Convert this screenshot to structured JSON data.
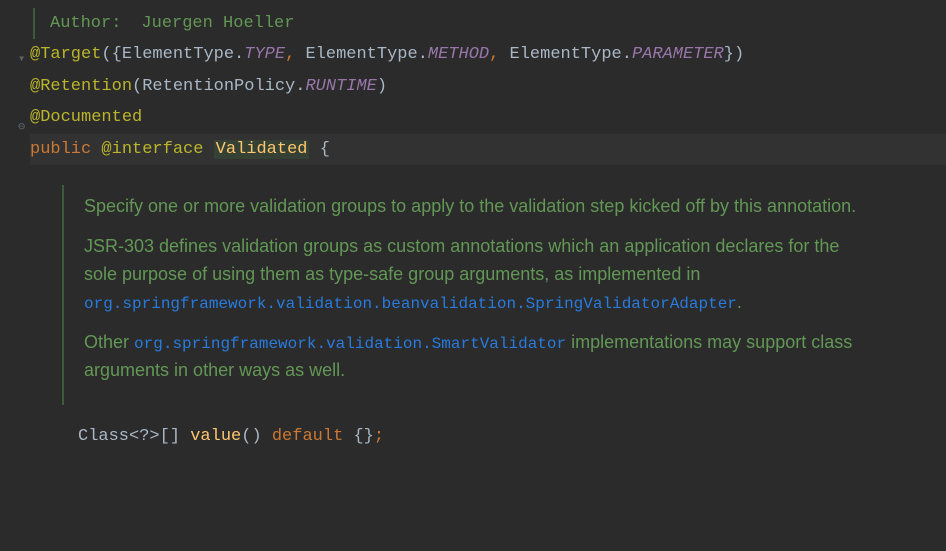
{
  "doc": {
    "authorLabel": "Author:",
    "authorName": "Juergen Hoeller"
  },
  "code": {
    "atTarget": "@Target",
    "openParen": "(",
    "openBrace": "{",
    "elementType": "ElementType",
    "dot": ".",
    "typeConst": "TYPE",
    "comma": ",",
    "methodConst": "METHOD",
    "parameterConst": "PARAMETER",
    "closeBrace": "}",
    "closeParen": ")",
    "atRetention": "@Retention",
    "retentionPolicy": "RetentionPolicy",
    "runtimeConst": "RUNTIME",
    "atDocumented": "@Documented",
    "publicKw": "public",
    "atInterface": "@interface",
    "className": "Validated"
  },
  "javadoc": {
    "p1": "Specify one or more validation groups to apply to the validation step kicked off by this annotation.",
    "p2a": "JSR-303 defines validation groups as custom annotations which an application declares for the sole purpose of using them as type-safe group arguments, as implemented in ",
    "p2code": "org.springframework.validation.beanvalidation.SpringValidatorAdapter",
    "p2b": ".",
    "p3a": "Other ",
    "p3code": "org.springframework.validation.SmartValidator",
    "p3b": " implementations may support class arguments in other ways as well."
  },
  "method": {
    "classKw": "Class",
    "generic": "<?>[]",
    "name": "value",
    "parens": "()",
    "defaultKw": "default",
    "emptyArr": "{}",
    "semi": ";"
  },
  "icons": {
    "collapse": "▾",
    "minus": "⊖"
  }
}
